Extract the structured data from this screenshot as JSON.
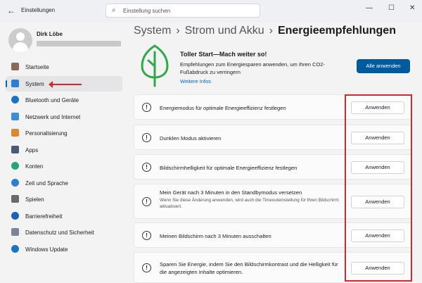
{
  "window": {
    "back_icon": "arrow-left-icon",
    "title": "Einstellungen",
    "search_placeholder": "Einstellung suchen",
    "controls": [
      "—",
      "☐",
      "✕"
    ]
  },
  "profile": {
    "name": "Dirk Löbe"
  },
  "sidebar": {
    "items": [
      {
        "label": "Startseite",
        "icon": "home-icon",
        "color": "#8a6a5a",
        "selected": false
      },
      {
        "label": "System",
        "icon": "monitor-icon",
        "color": "#2a7fd4",
        "selected": true
      },
      {
        "label": "Bluetooth und Geräte",
        "icon": "bluetooth-icon",
        "color": "#1a73c7",
        "selected": false
      },
      {
        "label": "Netzwerk und Internet",
        "icon": "wifi-icon",
        "color": "#3d8ed8",
        "selected": false
      },
      {
        "label": "Personalisierung",
        "icon": "brush-icon",
        "color": "#d98a2c",
        "selected": false
      },
      {
        "label": "Apps",
        "icon": "apps-icon",
        "color": "#4a5a7a",
        "selected": false
      },
      {
        "label": "Konten",
        "icon": "person-icon",
        "color": "#27a37a",
        "selected": false
      },
      {
        "label": "Zeit und Sprache",
        "icon": "globe-clock-icon",
        "color": "#2a7fd4",
        "selected": false
      },
      {
        "label": "Spielen",
        "icon": "gamepad-icon",
        "color": "#6a6a6a",
        "selected": false
      },
      {
        "label": "Barrierefreiheit",
        "icon": "accessibility-icon",
        "color": "#1a63b7",
        "selected": false
      },
      {
        "label": "Datenschutz und Sicherheit",
        "icon": "shield-icon",
        "color": "#7a8696",
        "selected": false
      },
      {
        "label": "Windows Update",
        "icon": "update-icon",
        "color": "#1a73c7",
        "selected": false
      }
    ]
  },
  "breadcrumb": {
    "items": [
      "System",
      "Strom und Akku"
    ],
    "separator": "›",
    "current": "Energieempfehlungen"
  },
  "hero": {
    "title": "Toller Start—Mach weiter so!",
    "description": "Empfehlungen zum Energiesparen anwenden, um Ihren CO2-Fußabdruck zu verringern",
    "link": "Weitere Infos",
    "apply_all": "Alle anwenden",
    "leaf_color": "#2ea84a"
  },
  "recommendations": [
    {
      "text": "Energiemodus für optimale Energieeffizienz festlegen",
      "sub": "",
      "button": "Anwenden"
    },
    {
      "text": "Dunklen Modus aktivieren",
      "sub": "",
      "button": "Anwenden"
    },
    {
      "text": "Bildschirmhelligkeit für optimale Energieeffizienz festlegen",
      "sub": "",
      "button": "Anwenden"
    },
    {
      "text": "Mein Gerät nach 3 Minuten in den Standbymodus versetzen",
      "sub": "Wenn Sie diese Änderung anwenden, wird auch die Timeouteinstellung für Ihren Bildschirm aktualisiert.",
      "button": "Anwenden"
    },
    {
      "text": "Meinen Bildschirm nach 3 Minuten ausschalten",
      "sub": "",
      "button": "Anwenden"
    },
    {
      "text": "Sparen Sie Energie, indem Sie den Bildschirmkontrast und die Helligkeit für die angezeigten Inhalte optimieren.",
      "sub": "",
      "button": "Anwenden"
    }
  ],
  "colors": {
    "accent": "#0067c0",
    "highlight": "#d8262b"
  }
}
